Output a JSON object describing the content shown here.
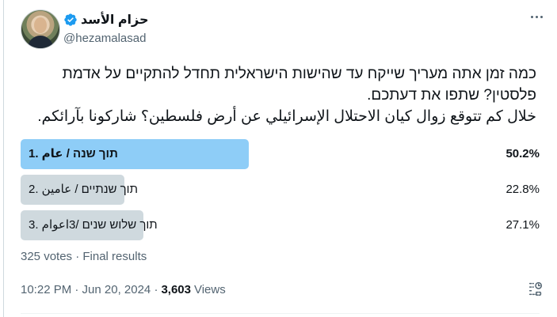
{
  "user": {
    "display_name": "حزام الأسد",
    "handle": "@hezamalasad"
  },
  "tweet": {
    "lines": [
      "כמה זמן אתה מעריך שייקח עד שהישות הישראלית תחדל להתקיים על אדמת",
      "פלסטין? שתפו את דעתכם.",
      "خلال كم تتوقع زوال كيان الاحتلال الإسرائيلي عن أرض فلسطين؟ شاركونا بآرائكم."
    ]
  },
  "poll": {
    "options": [
      {
        "label": "תוך שנה / عام .1",
        "percent_label": "50.2%",
        "percent": 50.2,
        "winner": true
      },
      {
        "label": "תוך שנתיים / عامين .2",
        "percent_label": "22.8%",
        "percent": 22.8,
        "winner": false
      },
      {
        "label": "תוך שלוש שנים /3اعوام .3",
        "percent_label": "27.1%",
        "percent": 27.1,
        "winner": false
      }
    ],
    "summary": "325 votes · Final results"
  },
  "meta": {
    "time_date": "10:22 PM · Jun 20, 2024 ·",
    "views_count": "3,603",
    "views_label": "Views"
  },
  "colors": {
    "winner_bar": "#8ecdf7",
    "other_bar": "#cfd9de",
    "verified": "#1d9bf0",
    "secondary_text": "#536471"
  },
  "icons": {
    "more": "more-horizontal-icon",
    "verified": "verified-badge-icon",
    "analytics": "analytics-icon"
  }
}
